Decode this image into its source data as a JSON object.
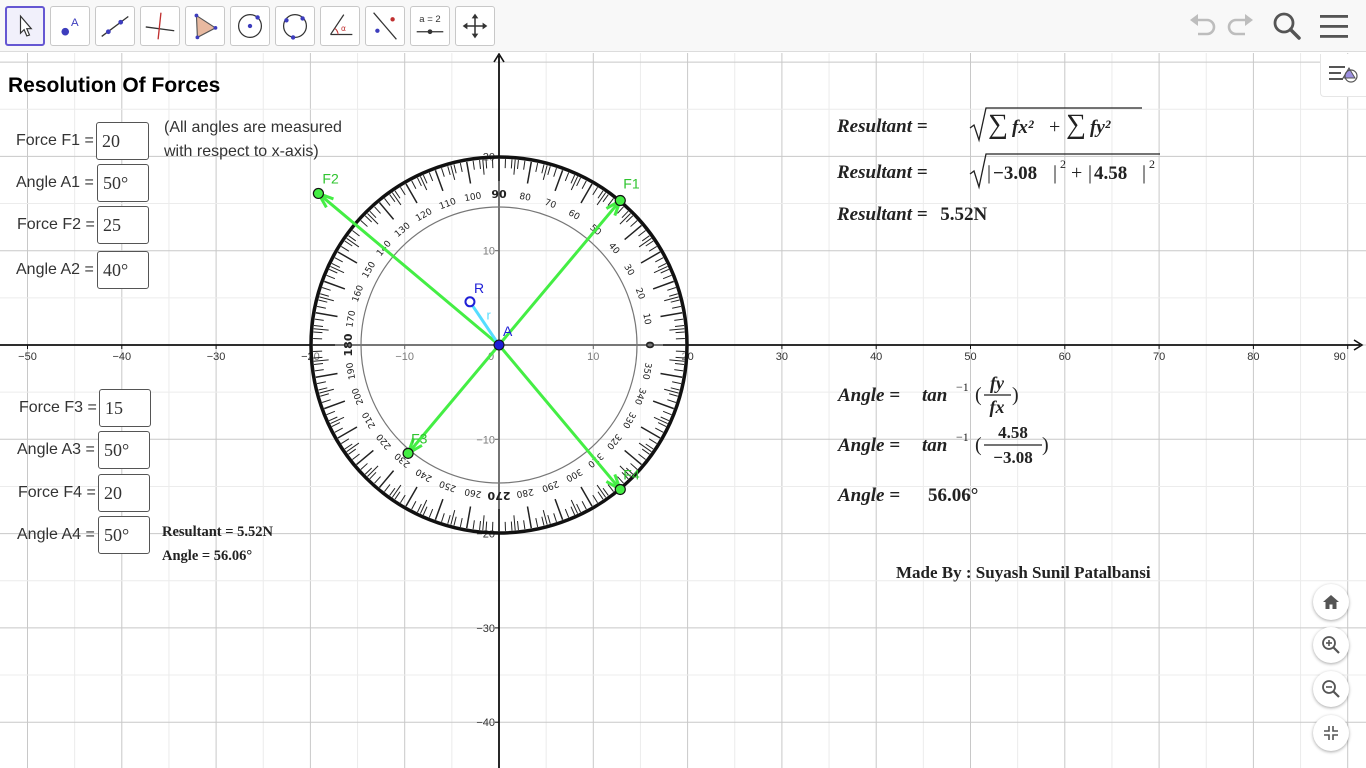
{
  "app": {
    "title": "Resolution Of Forces"
  },
  "toolbar": {
    "tools": [
      "Move",
      "Point",
      "Line",
      "Perpendicular Line",
      "Polygon",
      "Circle with Center through Point",
      "Circle through 3 Points",
      "Angle",
      "Reflect about Line",
      "Slider",
      "Move Graphics View"
    ],
    "slider_label": "a = 2",
    "point_label": "A",
    "undo": "undo-icon",
    "redo": "redo-icon",
    "search": "search-icon",
    "menu": "menu-icon"
  },
  "inputs": [
    {
      "label": "Force F1 =",
      "value": "20"
    },
    {
      "label": "Angle A1 =",
      "value": "50°"
    },
    {
      "label": "Force F2 =",
      "value": "25"
    },
    {
      "label": "Angle A2 =",
      "value": "40°"
    },
    {
      "label": "Force F3 =",
      "value": "15"
    },
    {
      "label": "Angle A3 =",
      "value": "50°"
    },
    {
      "label": "Force F4 =",
      "value": "20"
    },
    {
      "label": "Angle A4 =",
      "value": "50°"
    }
  ],
  "note": {
    "line1": "(All angles are measured",
    "line2": "with respect to x-axis)"
  },
  "summary": {
    "resultant": "Resultant = 5.52N",
    "angle": "Angle = 56.06°"
  },
  "formulas": {
    "resultant_label": "Resultant =",
    "sum_fx": "fx²",
    "sum_fy": "fy²",
    "abs_fx": "−3.08",
    "abs_fy": "4.58",
    "exp": "2",
    "resultant_value": "5.52N",
    "angle_label": "Angle =",
    "tan": "tan",
    "inv": "−1",
    "frac1_num": "fy",
    "frac1_den": "fx",
    "frac2_num": "4.58",
    "frac2_den": "−3.08",
    "angle_value": "56.06°"
  },
  "credit": "Made By : Suyash Sunil Patalbansi",
  "axes": {
    "x_ticks": [
      -50,
      -40,
      -30,
      -20,
      -10,
      0,
      10,
      20,
      30,
      40,
      50,
      60,
      70,
      80,
      90
    ],
    "y_ticks": [
      20,
      10,
      -10,
      -20,
      -30,
      -40
    ]
  },
  "protractor": {
    "outer_labels": [
      90,
      80,
      70,
      60,
      50,
      40,
      30,
      20,
      10,
      0,
      350,
      340,
      330,
      320,
      310,
      300,
      290,
      280,
      270,
      260,
      250,
      240,
      230,
      220,
      210,
      200,
      190,
      180,
      170,
      160,
      150,
      140,
      130,
      120,
      110,
      100
    ],
    "inner_labels": [
      90,
      80,
      70,
      60,
      50,
      40,
      30,
      20,
      10,
      0,
      350,
      340,
      330,
      320,
      310,
      300,
      290,
      280,
      270,
      260,
      250,
      240,
      230,
      220,
      210,
      200,
      190,
      180,
      170,
      160,
      150,
      140,
      130,
      120,
      110,
      100
    ]
  },
  "points": {
    "origin": {
      "label": "A",
      "x": 0,
      "y": 0
    },
    "R": {
      "label": "R",
      "x": -3.08,
      "y": 4.58
    },
    "r_label": "r",
    "F1": {
      "label": "F1",
      "x": 12.86,
      "y": 15.32
    },
    "F2": {
      "label": "F2",
      "x": -19.15,
      "y": 16.07
    },
    "F3": {
      "label": "F3",
      "x": -9.64,
      "y": -11.49
    },
    "F4": {
      "label": "F4",
      "x": 12.86,
      "y": -15.32
    }
  },
  "view_controls": [
    "home-icon",
    "zoom-in-icon",
    "zoom-out-icon",
    "exit-fullscreen-icon"
  ],
  "colors": {
    "force": "#44ee44",
    "resultant": "#55ddff",
    "point": "#1f1fd6",
    "accent": "#6557d2"
  }
}
